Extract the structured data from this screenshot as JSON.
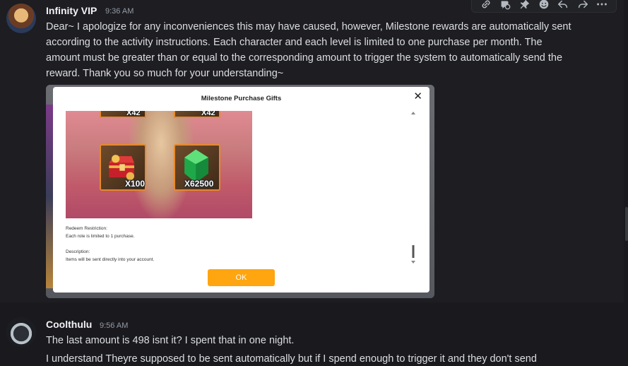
{
  "messages": [
    {
      "author": "Infinity VIP",
      "time": "9:36 AM",
      "lines": [
        "Dear~ I apologize for any inconveniences this may have caused, however, Milestone rewards are automatically sent",
        "according to the activity instructions. Each character and each level is limited to one purchase per month. The",
        "amount must be greater than or equal to the corresponding amount to trigger the system to automatically send the",
        "reward. Thank you so much for your understanding~"
      ]
    },
    {
      "author": "Coolthulu",
      "time": "9:56 AM",
      "lines": [
        "The last amount is 498 isnt it? I spent that in one night.",
        "I understand Theyre supposed to be sent automatically but if I spend enough to trigger it and they don't send"
      ]
    }
  ],
  "toolbar": {
    "icons": [
      "link-icon",
      "thread-icon",
      "pin-icon",
      "emoji-icon",
      "reply-icon",
      "forward-icon",
      "more-icon"
    ]
  },
  "modal": {
    "title": "Milestone Purchase Gifts",
    "close": "✕",
    "top_qty_left": "X42",
    "top_qty_right": "X42",
    "item_left_qty": "X100",
    "item_right_qty": "X62500",
    "restriction_label": "Redeem Restriction:",
    "restriction_text": "Each role is limited to 1 purchase.",
    "description_label": "Description:",
    "description_text": "Items will be sent directly into your account.",
    "ok_label": "OK"
  },
  "colors": {
    "accent_ok": "#ffa510",
    "slot_border": "#e7892a",
    "gem_green": "#1fa84a"
  }
}
